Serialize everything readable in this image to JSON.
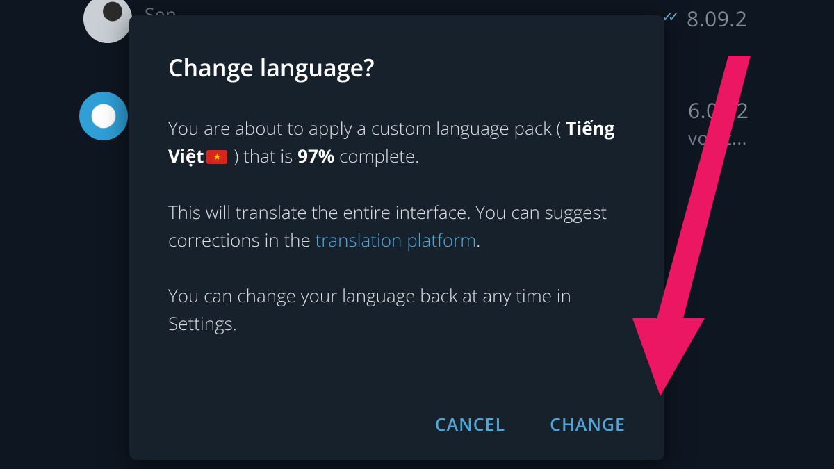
{
  "background": {
    "chat_name_partial": "Sen",
    "date1": "8.09.2",
    "date2": "6.08.2",
    "subtitle_partial": "vo-St..."
  },
  "dialog": {
    "title": "Change language?",
    "p1_lead": "You are about to apply a custom language pack ( ",
    "lang_name": "Tiếng Việt",
    "p1_mid": " ) that is ",
    "percent": "97%",
    "p1_tail": " complete.",
    "p2_lead": "This will translate the entire interface. You can suggest corrections in the ",
    "link_text": "translation platform",
    "p2_tail": ".",
    "p3": "You can change your language back at any time in Settings.",
    "cancel": "CANCEL",
    "change": "CHANGE"
  }
}
